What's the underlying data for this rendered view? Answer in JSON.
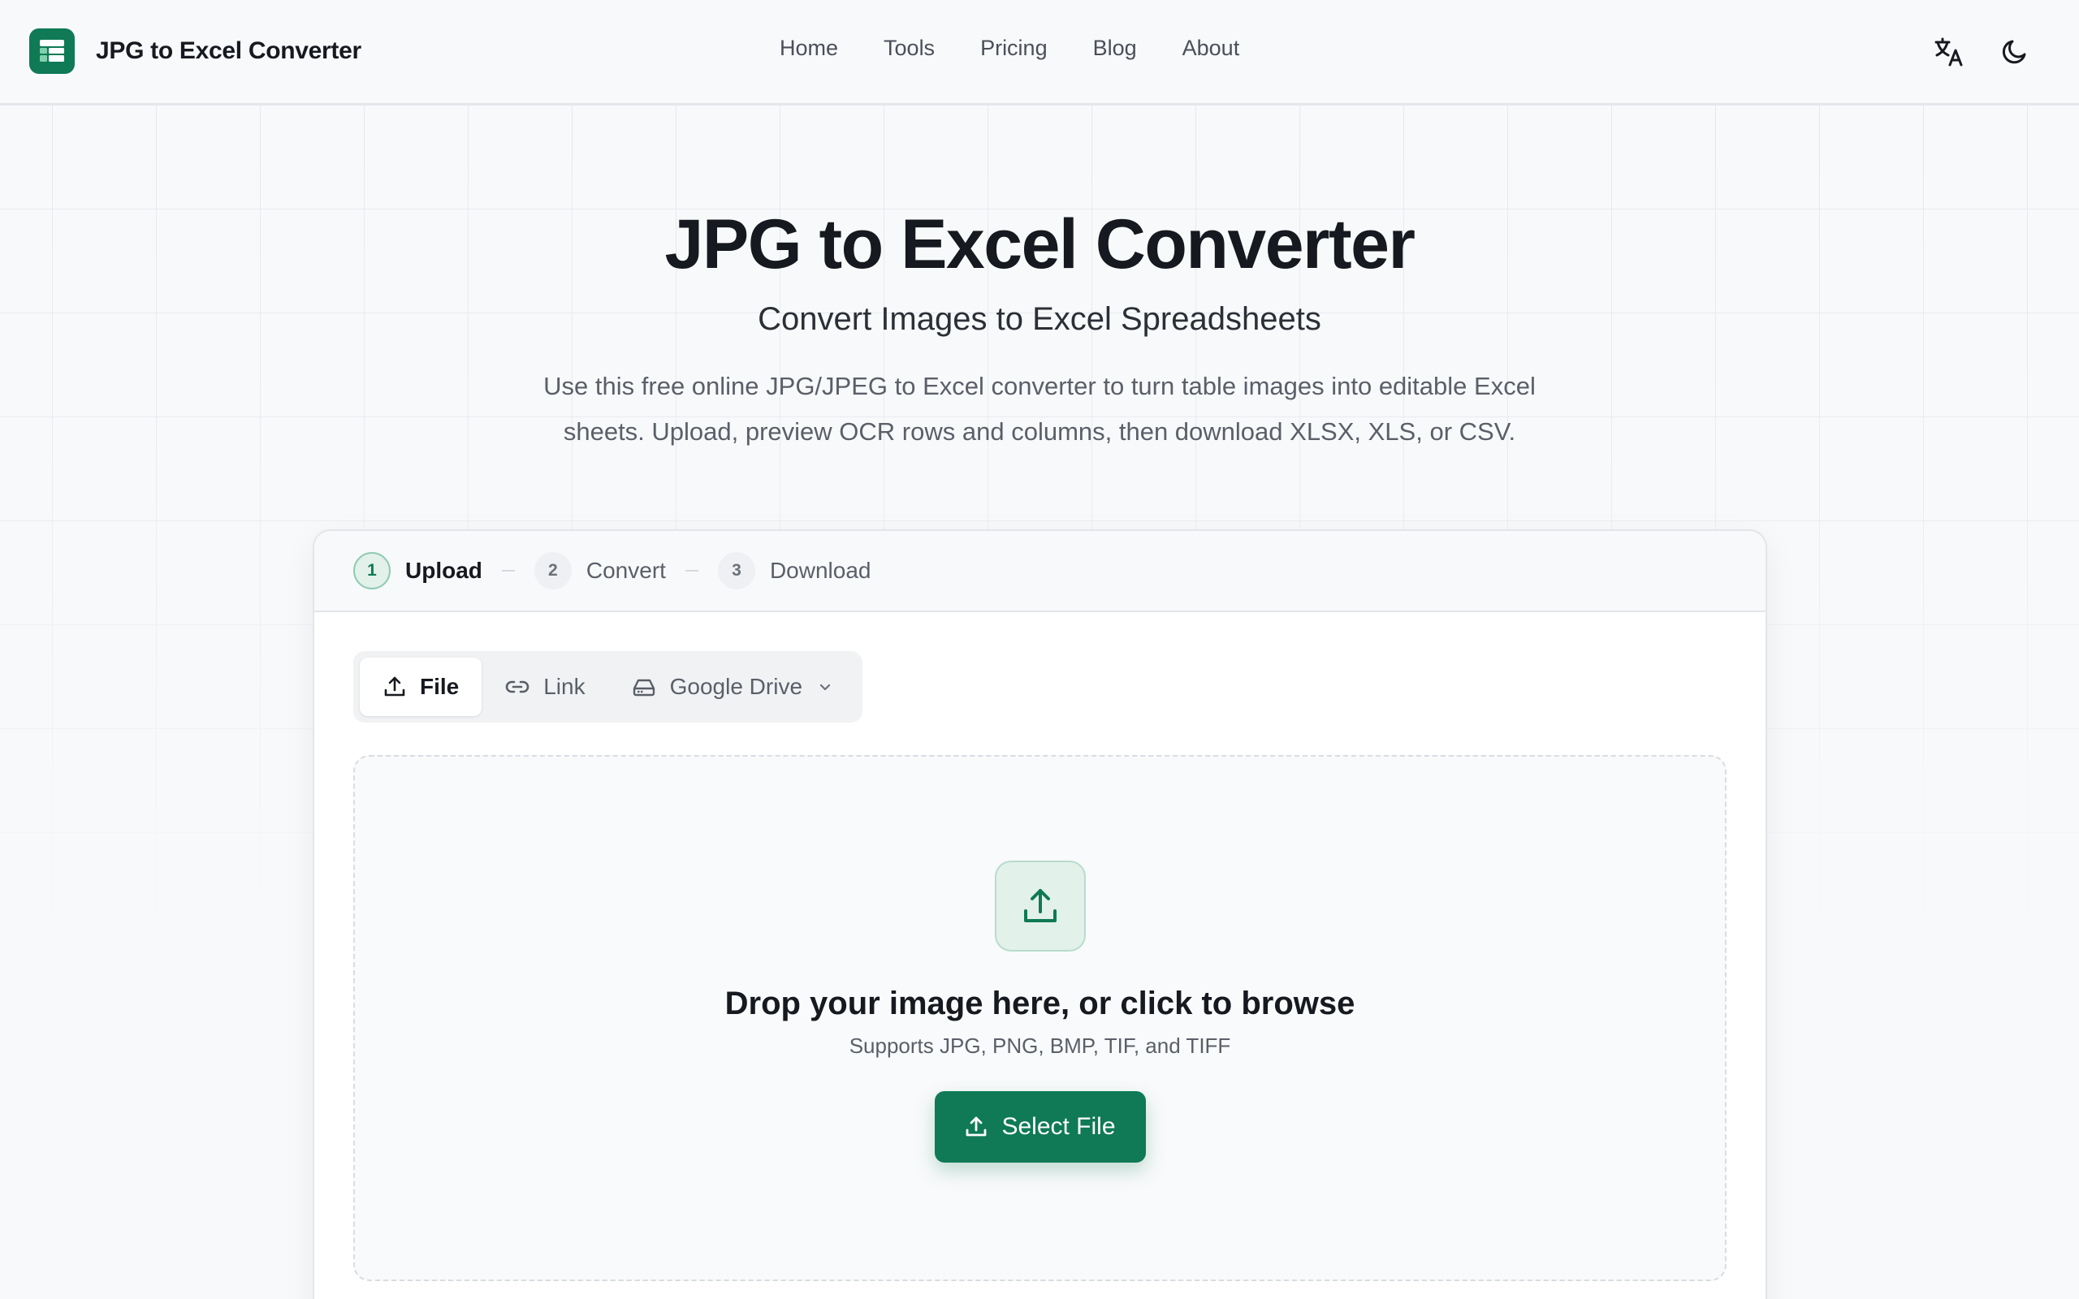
{
  "header": {
    "brand_name": "JPG to Excel Converter",
    "logo_icon": "spreadsheet-icon",
    "nav": [
      "Home",
      "Tools",
      "Pricing",
      "Blog",
      "About"
    ],
    "actions": [
      "translate-icon",
      "dark-mode-moon-icon"
    ]
  },
  "hero": {
    "title": "JPG to Excel Converter",
    "subtitle": "Convert Images to Excel Spreadsheets",
    "description": "Use this free online JPG/JPEG to Excel converter to turn table images into editable Excel sheets. Upload, preview OCR rows and columns, then download XLSX, XLS, or CSV."
  },
  "steps": [
    {
      "num": "1",
      "label": "Upload",
      "active": true
    },
    {
      "num": "2",
      "label": "Convert",
      "active": false
    },
    {
      "num": "3",
      "label": "Download",
      "active": false
    }
  ],
  "tabs": {
    "file": "File",
    "link": "Link",
    "drive": "Google Drive"
  },
  "dropzone": {
    "title": "Drop your image here, or click to browse",
    "hint": "Supports JPG, PNG, BMP, TIF, and TIFF",
    "button_label": "Select File"
  },
  "colors": {
    "brand": "#0f7a55",
    "brand_light": "#e2f1ea",
    "text": "#16191f",
    "muted": "#5a5f68"
  }
}
